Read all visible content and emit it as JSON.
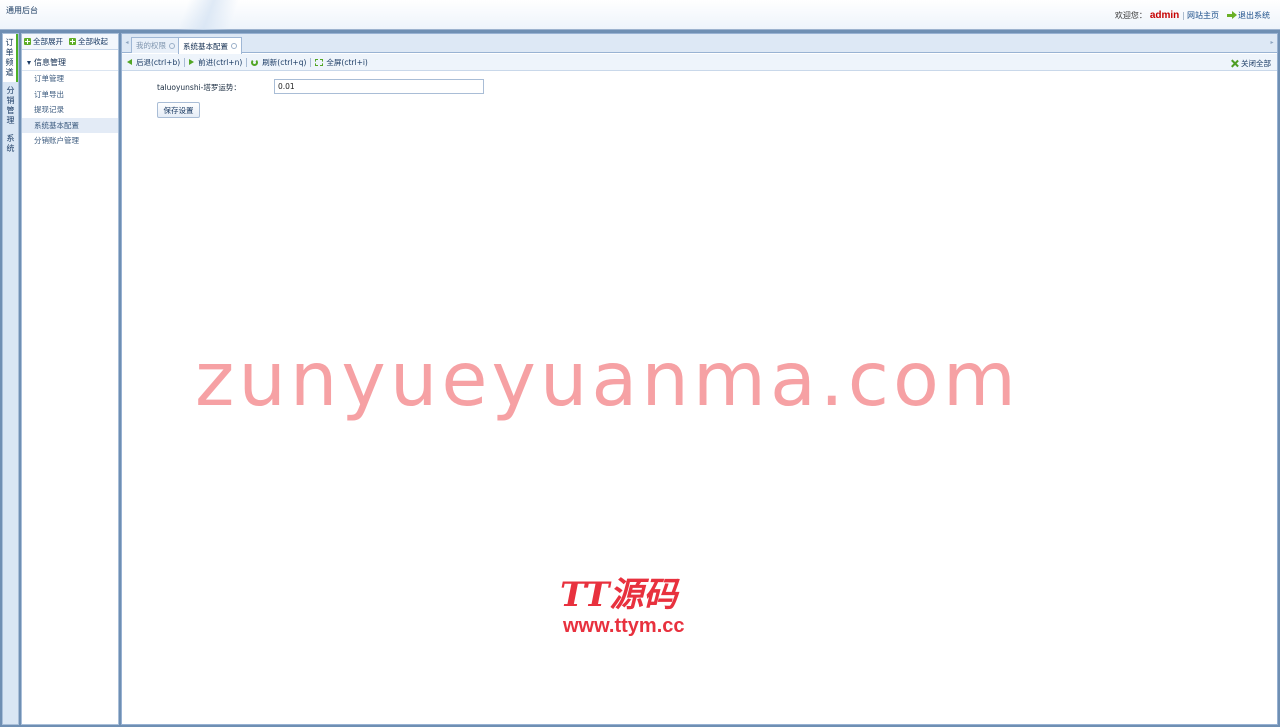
{
  "header": {
    "app_title": "通用后台",
    "welcome": "欢迎您：",
    "user": "admin",
    "separator": "|",
    "site_home": "网站主页",
    "logout": "退出系统",
    "accent_color": "#c60000"
  },
  "vtabs": [
    {
      "label": "订单频道",
      "active": true
    },
    {
      "label": "分销管理",
      "active": false
    },
    {
      "label": "系统",
      "active": false
    }
  ],
  "sidebar": {
    "expand_all": "全部展开",
    "collapse_all": "全部收起",
    "group": "信息管理",
    "items": [
      {
        "label": "订单管理"
      },
      {
        "label": "订单导出"
      },
      {
        "label": "提现记录"
      },
      {
        "label": "系统基本配置"
      },
      {
        "label": "分销账户管理"
      }
    ]
  },
  "tabs": [
    {
      "label": "我的权限",
      "active": false
    },
    {
      "label": "系统基本配置",
      "active": true
    }
  ],
  "toolbar": {
    "back": "后退(ctrl+b)",
    "forward": "前进(ctrl+n)",
    "refresh": "刷新(ctrl+q)",
    "fullscreen": "全屏(ctrl+i)",
    "close_all": "关闭全部"
  },
  "form": {
    "label": "taluoyunshi-塔罗运势：",
    "value": "0.01",
    "save": "保存设置"
  },
  "watermark": {
    "text": "zunyueyuanma.com",
    "logo_text": "TT源码",
    "logo_url": "www.ttym.cc"
  }
}
